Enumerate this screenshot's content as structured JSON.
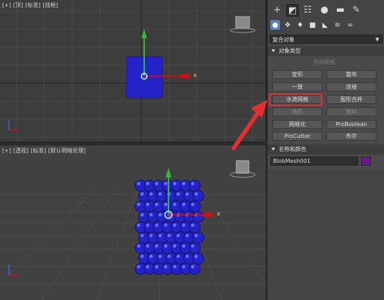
{
  "viewports": {
    "top": {
      "labels": [
        "[+]",
        "[顶]",
        "[标准]",
        "[线框]"
      ],
      "gizmo_axis": "x"
    },
    "perspective": {
      "labels": [
        "[+]",
        "[透视]",
        "[标准]",
        "[默认明暗处理]"
      ],
      "gizmo_axis": "x"
    }
  },
  "command_panel": {
    "tabs": [
      "create-tab",
      "modify-tab",
      "hierarchy-tab",
      "motion-tab",
      "display-tab",
      "utilities-tab"
    ],
    "subtabs": [
      "geometry",
      "shapes",
      "lights",
      "cameras",
      "helpers",
      "space-warps",
      "systems"
    ],
    "category_dropdown": {
      "value": "复合对象"
    },
    "object_type": {
      "header": "对象类型",
      "autogrid_label": "自动栅格",
      "buttons": [
        {
          "label": "变形",
          "enabled": true
        },
        {
          "label": "散布",
          "enabled": true
        },
        {
          "label": "一致",
          "enabled": true
        },
        {
          "label": "连接",
          "enabled": true
        },
        {
          "label": "水滴网格",
          "enabled": true
        },
        {
          "label": "图形合并",
          "enabled": true
        },
        {
          "label": "地形",
          "enabled": false
        },
        {
          "label": "放样",
          "enabled": false
        },
        {
          "label": "网格化",
          "enabled": true
        },
        {
          "label": "ProBoolean",
          "enabled": true
        },
        {
          "label": "ProCutter",
          "enabled": true
        },
        {
          "label": "布尔",
          "enabled": true
        }
      ]
    },
    "name_and_color": {
      "header": "名称和颜色",
      "name_value": "BlobMesh001",
      "color": "#6b1a8c"
    }
  },
  "colors": {
    "object_blue": "#2323c8",
    "highlight_red": "#e03030",
    "gizmo_x": "#d01010",
    "gizmo_y": "#2fc02f",
    "gizmo_z": "#3b6be8"
  }
}
